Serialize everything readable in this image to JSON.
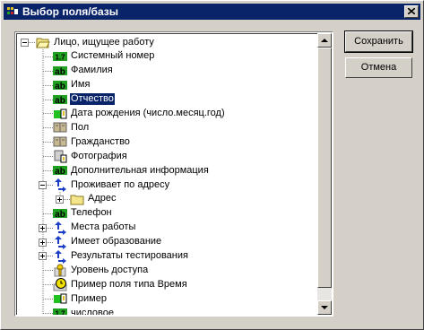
{
  "window": {
    "title": "Выбор поля/базы"
  },
  "buttons": {
    "save": "Сохранить",
    "cancel": "Отмена"
  },
  "tree": {
    "items": [
      {
        "label": "Лицо, ищущее работу",
        "icon": "folder-open-icon",
        "expander": "minus",
        "selected": false
      },
      {
        "label": "Системный номер",
        "icon": "number-field-icon",
        "selected": false
      },
      {
        "label": "Фамилия",
        "icon": "text-field-icon",
        "selected": false
      },
      {
        "label": "Имя",
        "icon": "text-field-icon",
        "selected": false
      },
      {
        "label": "Отчество",
        "icon": "text-field-icon",
        "selected": true
      },
      {
        "label": "Дата рождения (число.месяц.год)",
        "icon": "date-field-icon",
        "selected": false
      },
      {
        "label": "Пол",
        "icon": "book-field-icon",
        "selected": false
      },
      {
        "label": "Гражданство",
        "icon": "book-field-icon",
        "selected": false
      },
      {
        "label": "Фотография",
        "icon": "photo-field-icon",
        "selected": false
      },
      {
        "label": "Дополнительная информация",
        "icon": "text-field-icon",
        "selected": false
      },
      {
        "label": "Проживает по адресу",
        "icon": "link-field-icon",
        "expander": "minus",
        "selected": false
      },
      {
        "label": "Адрес",
        "icon": "folder-icon",
        "expander": "plus",
        "selected": false
      },
      {
        "label": "Телефон",
        "icon": "text-field-icon",
        "selected": false
      },
      {
        "label": "Места работы",
        "icon": "link-field-icon",
        "expander": "plus",
        "selected": false
      },
      {
        "label": "Имеет образование",
        "icon": "link-field-icon",
        "expander": "plus",
        "selected": false
      },
      {
        "label": "Результаты тестирования",
        "icon": "link-field-icon",
        "expander": "plus",
        "selected": false
      },
      {
        "label": "Уровень доступа",
        "icon": "key-field-icon",
        "selected": false
      },
      {
        "label": "Пример поля типа Время",
        "icon": "clock-field-icon",
        "selected": false
      },
      {
        "label": "Пример",
        "icon": "date-field-icon",
        "selected": false
      },
      {
        "label": "числовое",
        "icon": "number-field-icon",
        "selected": false
      }
    ]
  },
  "icon_text": {
    "number": "1.7",
    "text": "ab"
  }
}
